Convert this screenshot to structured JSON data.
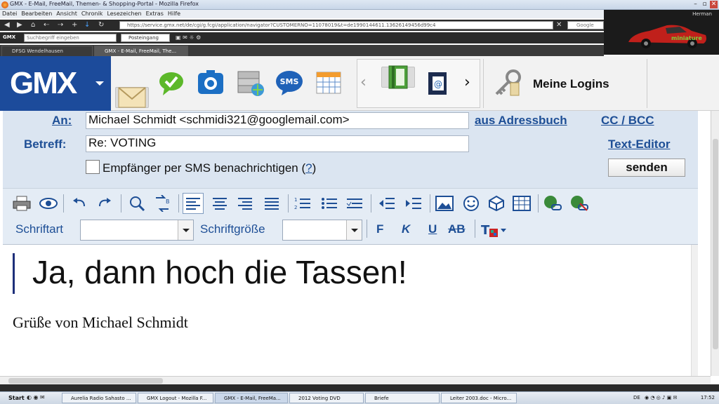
{
  "browser": {
    "window_title": "GMX - E-Mail, FreeMail, Themen- & Shopping-Portal - Mozilla Firefox",
    "menu": [
      "Datei",
      "Bearbeiten",
      "Ansicht",
      "Chronik",
      "Lesezeichen",
      "Extras",
      "Hilfe"
    ],
    "url": "https://service.gmx.net/de/cgi/g.fcgi/application/navigator?CUSTOMERNO=11078019&t=de1990144611.13626149456d99c4",
    "search_engine": "Google",
    "web_search_placeholder": "Suchbegriff eingeben",
    "posteingang": "Posteingang",
    "gmx_mini": "GMX",
    "banner_user": "Herman",
    "banner_brand": "miniature",
    "tabs": [
      {
        "label": "DFSG Wendelhausen",
        "active": false
      },
      {
        "label": "GMX - E-Mail, FreeMail, The...",
        "active": true
      }
    ]
  },
  "gmx": {
    "logo": "GMX",
    "meine_logins": "Meine Logins"
  },
  "compose": {
    "to_label": "An:",
    "to_value": "Michael Schmidt <schmidi321@googlemail.com>",
    "addressbook_link": "aus Adressbuch",
    "ccbcc_link": "CC / BCC",
    "subject_label": "Betreff:",
    "subject_value": "Re: VOTING",
    "text_editor_link": "Text-Editor",
    "sms_label": "Empfänger per SMS benachrichtigen (",
    "sms_help": "?",
    "sms_close": ")",
    "send_button": "senden"
  },
  "editor_toolbar": {
    "font_label": "Schriftart",
    "size_label": "Schriftgröße",
    "bold": "F",
    "italic": "K",
    "underline": "U",
    "strike": "AB"
  },
  "editor": {
    "big_text": "Ja, dann hoch die Tassen!",
    "greeting": "Grüße von Michael Schmidt"
  },
  "taskbar": {
    "start": "Start",
    "tasks": [
      {
        "label": "Aurelia Radio Sahasto ...",
        "active": false
      },
      {
        "label": "GMX Logout - Mozilla F...",
        "active": false
      },
      {
        "label": "GMX - E-Mail, FreeMa...",
        "active": true
      },
      {
        "label": "2012 Voting DVD",
        "active": false
      },
      {
        "label": "Briefe",
        "active": false
      },
      {
        "label": "Leiter 2003.doc - Micro...",
        "active": false
      }
    ],
    "lang": "DE",
    "clock": "17:52"
  },
  "colors": {
    "gmx_blue": "#1c4b9b",
    "link_blue": "#1e4f96",
    "compose_bg": "#dbe5f1"
  }
}
